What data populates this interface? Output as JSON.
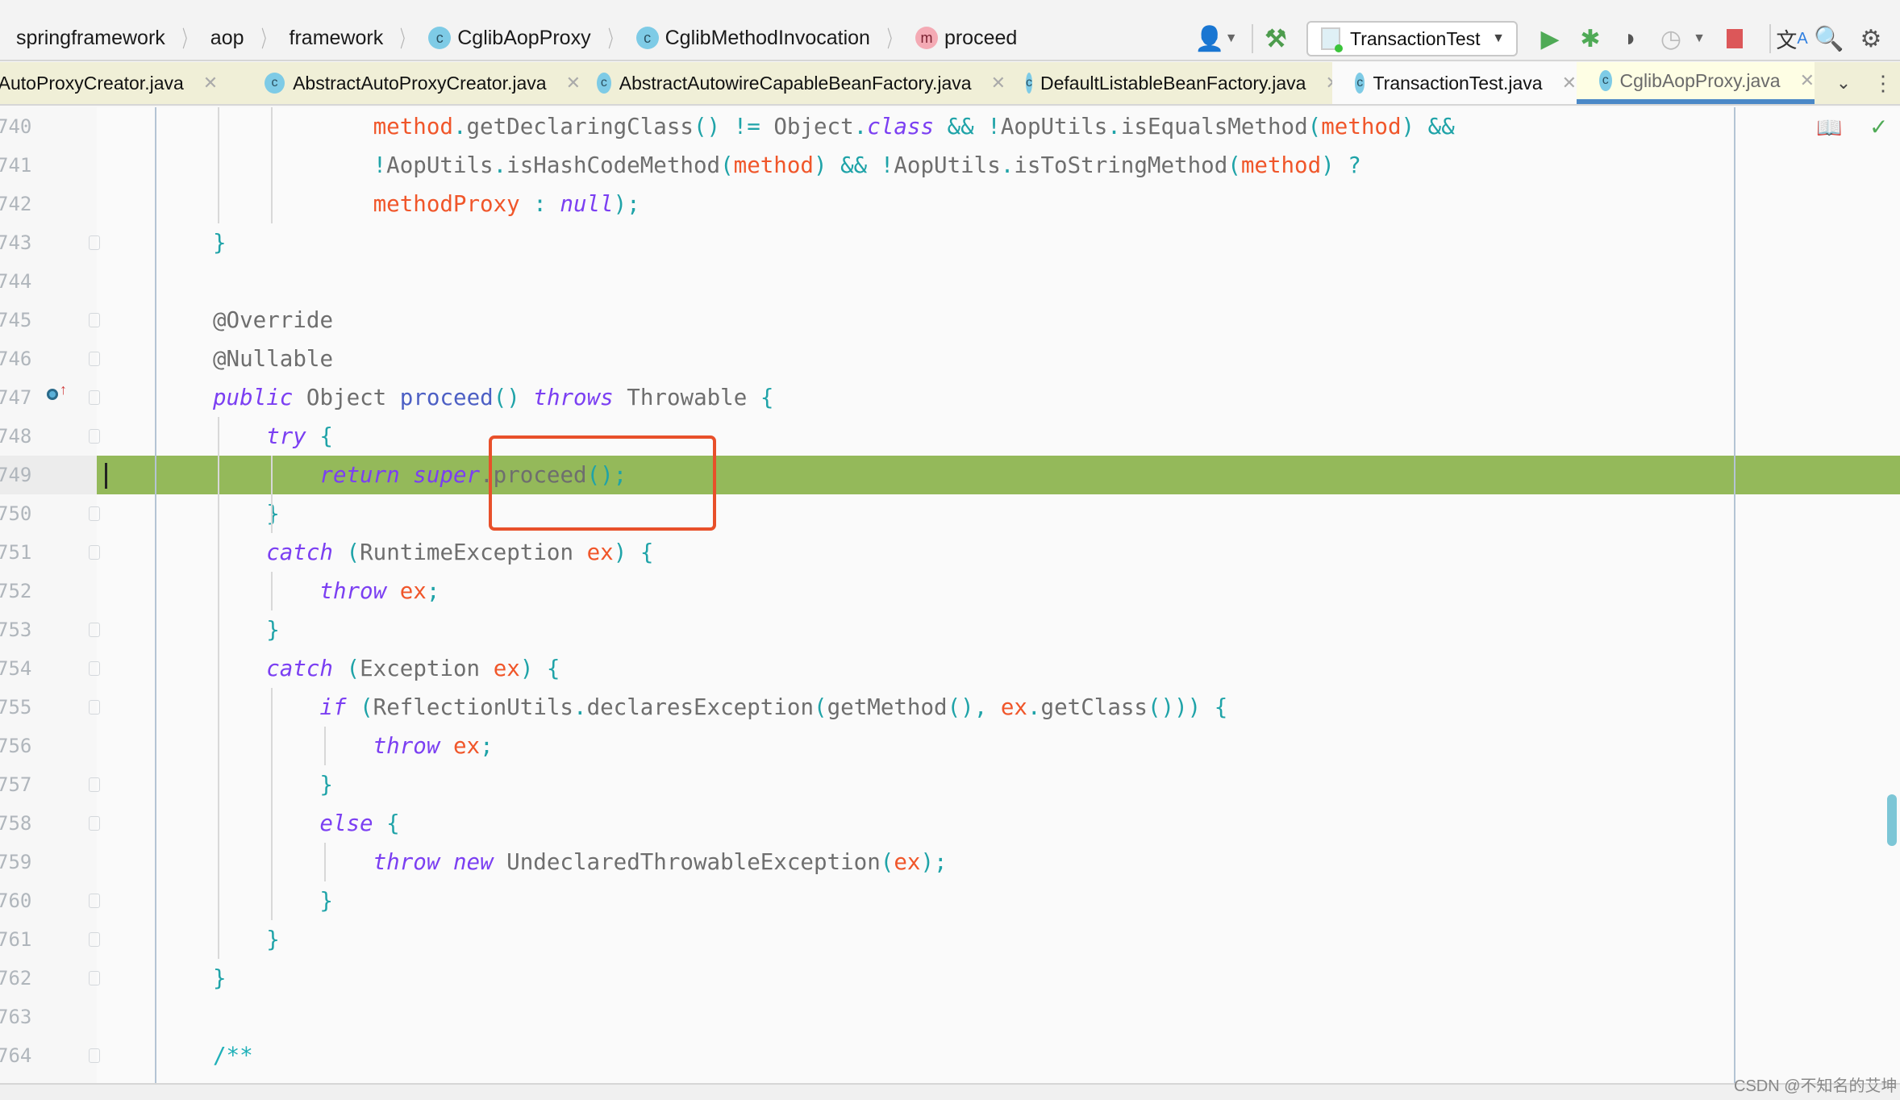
{
  "breadcrumbs": [
    {
      "label": "springframework",
      "icon": null
    },
    {
      "label": "aop",
      "icon": null
    },
    {
      "label": "framework",
      "icon": null
    },
    {
      "label": "CglibAopProxy",
      "icon": "class-icon"
    },
    {
      "label": "CglibMethodInvocation",
      "icon": "class-icon"
    },
    {
      "label": "proceed",
      "icon": "method-icon"
    }
  ],
  "toolbar": {
    "run_config": "TransactionTest",
    "class_glyph": "c",
    "method_glyph": "m"
  },
  "tabs": [
    {
      "label": "rAutoProxyCreator.java",
      "state": "normal"
    },
    {
      "label": "AbstractAutoProxyCreator.java",
      "state": "normal"
    },
    {
      "label": "AbstractAutowireCapableBeanFactory.java",
      "state": "normal"
    },
    {
      "label": "DefaultListableBeanFactory.java",
      "state": "normal"
    },
    {
      "label": "TransactionTest.java",
      "state": "open"
    },
    {
      "label": "CglibAopProxy.java",
      "state": "active"
    }
  ],
  "editor": {
    "current_line": "749",
    "lines": [
      {
        "n": "740",
        "indent": 12,
        "t": [
          [
            "method",
            "fld"
          ],
          [
            ".",
            "pn"
          ],
          [
            "getDeclaringClass",
            "id"
          ],
          [
            "()",
            "pn"
          ],
          [
            " != ",
            "pn"
          ],
          [
            "Object",
            "id"
          ],
          [
            ".",
            "pn"
          ],
          [
            "class",
            "kw"
          ],
          [
            " && ",
            "pn"
          ],
          [
            "!",
            "pn"
          ],
          [
            "AopUtils",
            "id"
          ],
          [
            ".",
            "pn"
          ],
          [
            "isEqualsMethod",
            "id"
          ],
          [
            "(",
            "pn"
          ],
          [
            "method",
            "fld"
          ],
          [
            ")",
            "pn"
          ],
          [
            " &&",
            "pn"
          ]
        ]
      },
      {
        "n": "741",
        "indent": 12,
        "t": [
          [
            "!",
            "pn"
          ],
          [
            "AopUtils",
            "id"
          ],
          [
            ".",
            "pn"
          ],
          [
            "isHashCodeMethod",
            "id"
          ],
          [
            "(",
            "pn"
          ],
          [
            "method",
            "fld"
          ],
          [
            ")",
            "pn"
          ],
          [
            " && ",
            "pn"
          ],
          [
            "!",
            "pn"
          ],
          [
            "AopUtils",
            "id"
          ],
          [
            ".",
            "pn"
          ],
          [
            "isToStringMethod",
            "id"
          ],
          [
            "(",
            "pn"
          ],
          [
            "method",
            "fld"
          ],
          [
            ")",
            "pn"
          ],
          [
            " ?",
            "pn"
          ]
        ]
      },
      {
        "n": "742",
        "indent": 12,
        "t": [
          [
            "methodProxy",
            "fld"
          ],
          [
            " : ",
            "pn"
          ],
          [
            "null",
            "kw"
          ],
          [
            ");",
            "pn"
          ]
        ]
      },
      {
        "n": "743",
        "indent": 0,
        "t": [
          [
            "}",
            "pn"
          ]
        ]
      },
      {
        "n": "744",
        "indent": 0,
        "t": []
      },
      {
        "n": "745",
        "indent": 0,
        "t": [
          [
            "@Override",
            "id"
          ]
        ]
      },
      {
        "n": "746",
        "indent": 0,
        "t": [
          [
            "@Nullable",
            "id"
          ]
        ]
      },
      {
        "n": "747",
        "indent": 0,
        "t": [
          [
            "public",
            "kw"
          ],
          [
            " Object ",
            "id"
          ],
          [
            "proceed",
            "mth"
          ],
          [
            "()",
            "pn"
          ],
          [
            " ",
            "id"
          ],
          [
            "throws",
            "kw"
          ],
          [
            " Throwable ",
            "id"
          ],
          [
            "{",
            "pn"
          ]
        ]
      },
      {
        "n": "748",
        "indent": 4,
        "t": [
          [
            "try",
            "kw"
          ],
          [
            " {",
            "pn"
          ]
        ]
      },
      {
        "n": "749",
        "indent": 8,
        "t": [
          [
            "return",
            "kw"
          ],
          [
            " ",
            "id"
          ],
          [
            "super",
            "kw"
          ],
          [
            ".",
            "id"
          ],
          [
            "proceed",
            "id"
          ],
          [
            "();",
            "pn"
          ]
        ]
      },
      {
        "n": "750",
        "indent": 4,
        "t": [
          [
            "}",
            "pn"
          ]
        ]
      },
      {
        "n": "751",
        "indent": 4,
        "t": [
          [
            "catch",
            "kw"
          ],
          [
            " (",
            "pn"
          ],
          [
            "RuntimeException ",
            "id"
          ],
          [
            "ex",
            "fld"
          ],
          [
            ") {",
            "pn"
          ]
        ]
      },
      {
        "n": "752",
        "indent": 8,
        "t": [
          [
            "throw",
            "kw"
          ],
          [
            " ",
            "id"
          ],
          [
            "ex",
            "fld"
          ],
          [
            ";",
            "pn"
          ]
        ]
      },
      {
        "n": "753",
        "indent": 4,
        "t": [
          [
            "}",
            "pn"
          ]
        ]
      },
      {
        "n": "754",
        "indent": 4,
        "t": [
          [
            "catch",
            "kw"
          ],
          [
            " (",
            "pn"
          ],
          [
            "Exception ",
            "id"
          ],
          [
            "ex",
            "fld"
          ],
          [
            ") {",
            "pn"
          ]
        ]
      },
      {
        "n": "755",
        "indent": 8,
        "t": [
          [
            "if",
            "kw"
          ],
          [
            " (",
            "pn"
          ],
          [
            "ReflectionUtils",
            "id"
          ],
          [
            ".",
            "pn"
          ],
          [
            "declaresException",
            "id"
          ],
          [
            "(",
            "pn"
          ],
          [
            "getMethod",
            "id"
          ],
          [
            "(), ",
            "pn"
          ],
          [
            "ex",
            "fld"
          ],
          [
            ".",
            "pn"
          ],
          [
            "getClass",
            "id"
          ],
          [
            "())) {",
            "pn"
          ]
        ]
      },
      {
        "n": "756",
        "indent": 12,
        "t": [
          [
            "throw",
            "kw"
          ],
          [
            " ",
            "id"
          ],
          [
            "ex",
            "fld"
          ],
          [
            ";",
            "pn"
          ]
        ]
      },
      {
        "n": "757",
        "indent": 8,
        "t": [
          [
            "}",
            "pn"
          ]
        ]
      },
      {
        "n": "758",
        "indent": 8,
        "t": [
          [
            "else",
            "kw"
          ],
          [
            " {",
            "pn"
          ]
        ]
      },
      {
        "n": "759",
        "indent": 12,
        "t": [
          [
            "throw",
            "kw"
          ],
          [
            " ",
            "id"
          ],
          [
            "new",
            "kw"
          ],
          [
            " UndeclaredThrowableException",
            "id"
          ],
          [
            "(",
            "pn"
          ],
          [
            "ex",
            "fld"
          ],
          [
            ");",
            "pn"
          ]
        ]
      },
      {
        "n": "760",
        "indent": 8,
        "t": [
          [
            "}",
            "pn"
          ]
        ]
      },
      {
        "n": "761",
        "indent": 4,
        "t": [
          [
            "}",
            "pn"
          ]
        ]
      },
      {
        "n": "762",
        "indent": 0,
        "t": [
          [
            "}",
            "pn"
          ]
        ]
      },
      {
        "n": "763",
        "indent": 0,
        "t": []
      },
      {
        "n": "764",
        "indent": 0,
        "t": [
          [
            "/**",
            "cm"
          ]
        ]
      }
    ]
  },
  "colors": {
    "highlight": "#94b95a",
    "annotation_box": "#e8502a",
    "active_tab_underline": "#4a88c7",
    "keyword": "#7b3ff2",
    "field": "#f0562a"
  },
  "watermark": "CSDN @不知名的艾坤"
}
